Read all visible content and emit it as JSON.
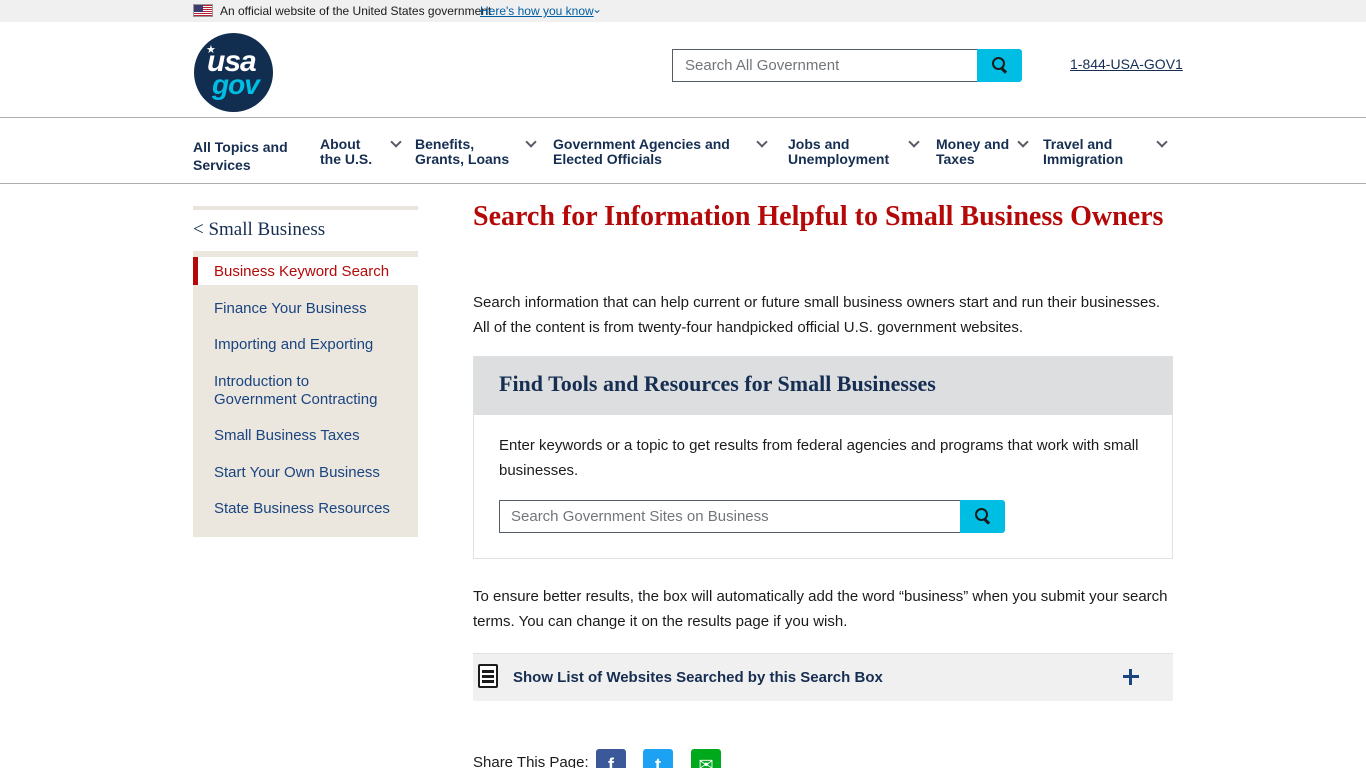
{
  "banner": {
    "official_text": "An official website of the United States government",
    "how_link": "Here's how you know"
  },
  "header": {
    "logo_usa": "usa",
    "logo_gov": "gov",
    "search_placeholder": "Search All Government",
    "phone": "1-844-USA-GOV1"
  },
  "nav": {
    "items": [
      {
        "line1": "All Topics and",
        "line2": "Services"
      },
      {
        "line1": "About",
        "line2": "the U.S."
      },
      {
        "line1": "Benefits,",
        "line2": "Grants, Loans"
      },
      {
        "line1": "Government Agencies and",
        "line2": "Elected Officials"
      },
      {
        "line1": "Jobs and",
        "line2": "Unemployment"
      },
      {
        "line1": "Money and",
        "line2": "Taxes"
      },
      {
        "line1": "Travel and",
        "line2": "Immigration"
      }
    ]
  },
  "sidebar": {
    "title": "< Small Business",
    "items": [
      {
        "label": "Business Keyword Search"
      },
      {
        "label": "Finance Your Business"
      },
      {
        "label": "Importing and Exporting"
      },
      {
        "label": "Introduction to",
        "label2": "Government Contracting"
      },
      {
        "label": "Small Business Taxes"
      },
      {
        "label": "Start Your Own Business"
      },
      {
        "label": "State Business Resources"
      }
    ]
  },
  "main": {
    "title": "Search for Information Helpful to Small Business Owners",
    "intro": "Search information that can help current or future small business owners start and run their businesses. All of the content is from twenty-four handpicked official U.S. government websites.",
    "tool_heading": "Find Tools and Resources for Small Businesses",
    "tool_desc": "Enter keywords or a topic to get results from federal agencies and programs that work with small businesses.",
    "tool_search_placeholder": "Search Government Sites on Business",
    "note": "To ensure better results, the box will automatically add the word “business” when you submit your search terms. You can change it on the results page if you wish.",
    "accordion_label": "Show List of Websites Searched by this Search Box",
    "share_label": "Share This Page:"
  },
  "share": {
    "facebook": "f",
    "twitter": "t",
    "email": "✉"
  }
}
